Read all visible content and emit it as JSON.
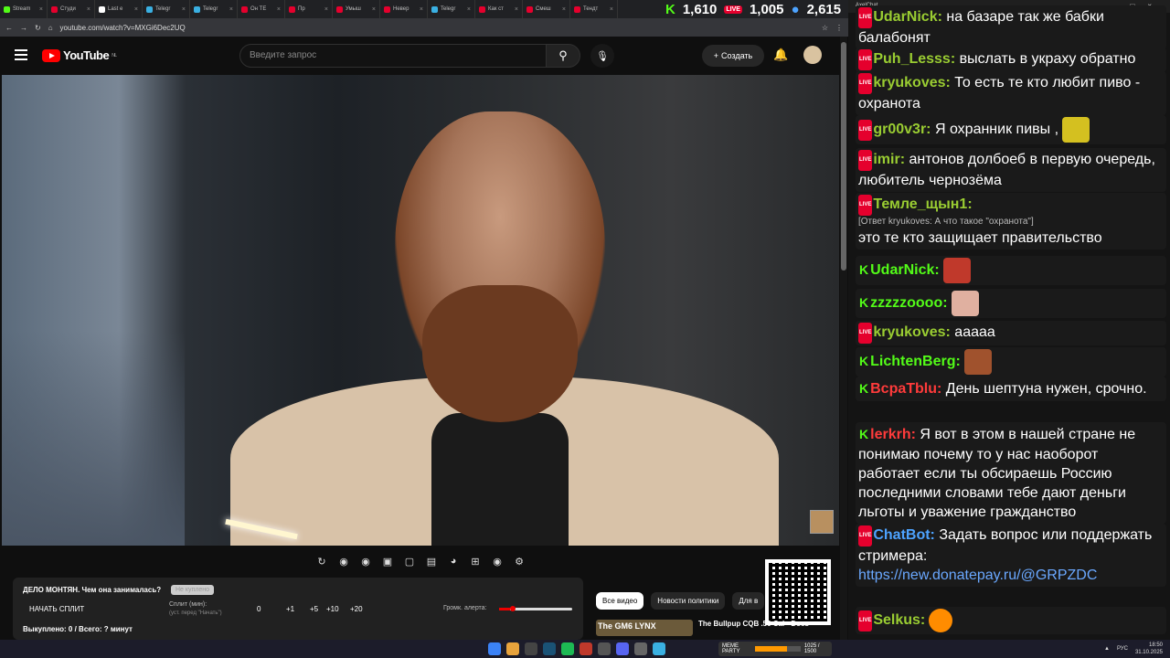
{
  "browser": {
    "tabs": [
      "Stream",
      "Студи",
      "Last e",
      "Telegr",
      "Telegr",
      "Он ТЕ",
      "Пр",
      "Умыш",
      "Невер",
      "Telegr",
      "Как ст",
      "Смеш",
      "Тендт"
    ],
    "url": "youtube.com/watch?v=MXGi6Dec2UQ"
  },
  "stats": {
    "kick_viewers": "1,610",
    "yt_viewers": "1,005",
    "total_viewers": "2,615",
    "live_label": "LIVE"
  },
  "youtube": {
    "logo_text": "YouTube",
    "region": "NL",
    "search_placeholder": "Введите запрос",
    "create_label": "Создать"
  },
  "widget": {
    "title": "ДЕЛО МОНТЯН. Чем она занималась?",
    "badge": "Не куплено",
    "start_button": "НАЧАТЬ СПЛИТ",
    "split_label": "Сплит (мин):",
    "split_hint": "(уст. перед \"Начать\")",
    "split_value": "0",
    "increments": [
      "+1",
      "+5",
      "+10",
      "+20"
    ],
    "volume_label": "Громк. алерта:",
    "volume_level": 0.15,
    "footer": "Выкуплено: 0 / Всего: ? минут"
  },
  "chips": [
    "Все видео",
    "Новости политики",
    "Для в"
  ],
  "reco": {
    "thumb_text": "The GM6 LYNX",
    "title": "The Bullpup CQB .50 Cal - Does"
  },
  "chat": {
    "window_title": "AxelChat",
    "messages": [
      {
        "platform": "yt",
        "nick": "UdarNick:",
        "color": "#9acd32",
        "text": "на базаре так же бабки балабонят"
      },
      {
        "platform": "yt",
        "nick": "Puh_Lesss:",
        "color": "#9acd32",
        "text": "выслать в украху обратно"
      },
      {
        "platform": "yt",
        "nick": "kryukoves:",
        "color": "#9acd32",
        "text": "То есть те кто любит пиво - охранота"
      },
      {
        "platform": "yt",
        "nick": "gr00v3r:",
        "color": "#9acd32",
        "text": "Я охранник пивы ,"
      },
      {
        "platform": "yt",
        "nick": "imir:",
        "color": "#9acd32",
        "text": "антонов долбоеб в первую очередь, любитель чернозёма"
      },
      {
        "platform": "yt",
        "nick": "Темле_щын1:",
        "color": "#9acd32",
        "reply": "[Ответ kryukoves: А что такое \"охранота\"]",
        "text": "это те кто защищает правительство"
      },
      {
        "platform": "kick",
        "nick": "UdarNick:",
        "color": "#53fc18",
        "text": ""
      },
      {
        "platform": "kick",
        "nick": "zzzzzoooo:",
        "color": "#53fc18",
        "text": ""
      },
      {
        "platform": "yt",
        "nick": "kryukoves:",
        "color": "#9acd32",
        "text": "ааааа"
      },
      {
        "platform": "kick",
        "nick": "LichtenBerg:",
        "color": "#53fc18",
        "text": ""
      },
      {
        "platform": "kick",
        "nick": "ВсраТblu:",
        "color": "#ff3b3b",
        "text": "День шептуна нужен, срочно."
      },
      {
        "platform": "kick",
        "nick": "lerkrh:",
        "color": "#ff3b3b",
        "text": "Я вот в этом в нашей стране не понимаю почему то у нас наоборот работает если ты обсираешь Россию последними словами тебе дают деньги льготы и уважение гражданство"
      },
      {
        "platform": "yt",
        "nick": "ChatBot:",
        "color": "#4da3ff",
        "text": "Задать вопрос или поддержать стримера:",
        "link": "https://new.donatepay.ru/@GRPZDC"
      },
      {
        "platform": "yt",
        "nick": "Selkus:",
        "color": "#9acd32",
        "text": ""
      }
    ]
  },
  "taskbar": {
    "meme": "MEME PARTY",
    "meme_count": "1025 / 1500",
    "lang": "РУС",
    "time": "18:50",
    "date": "31.10.2025"
  }
}
